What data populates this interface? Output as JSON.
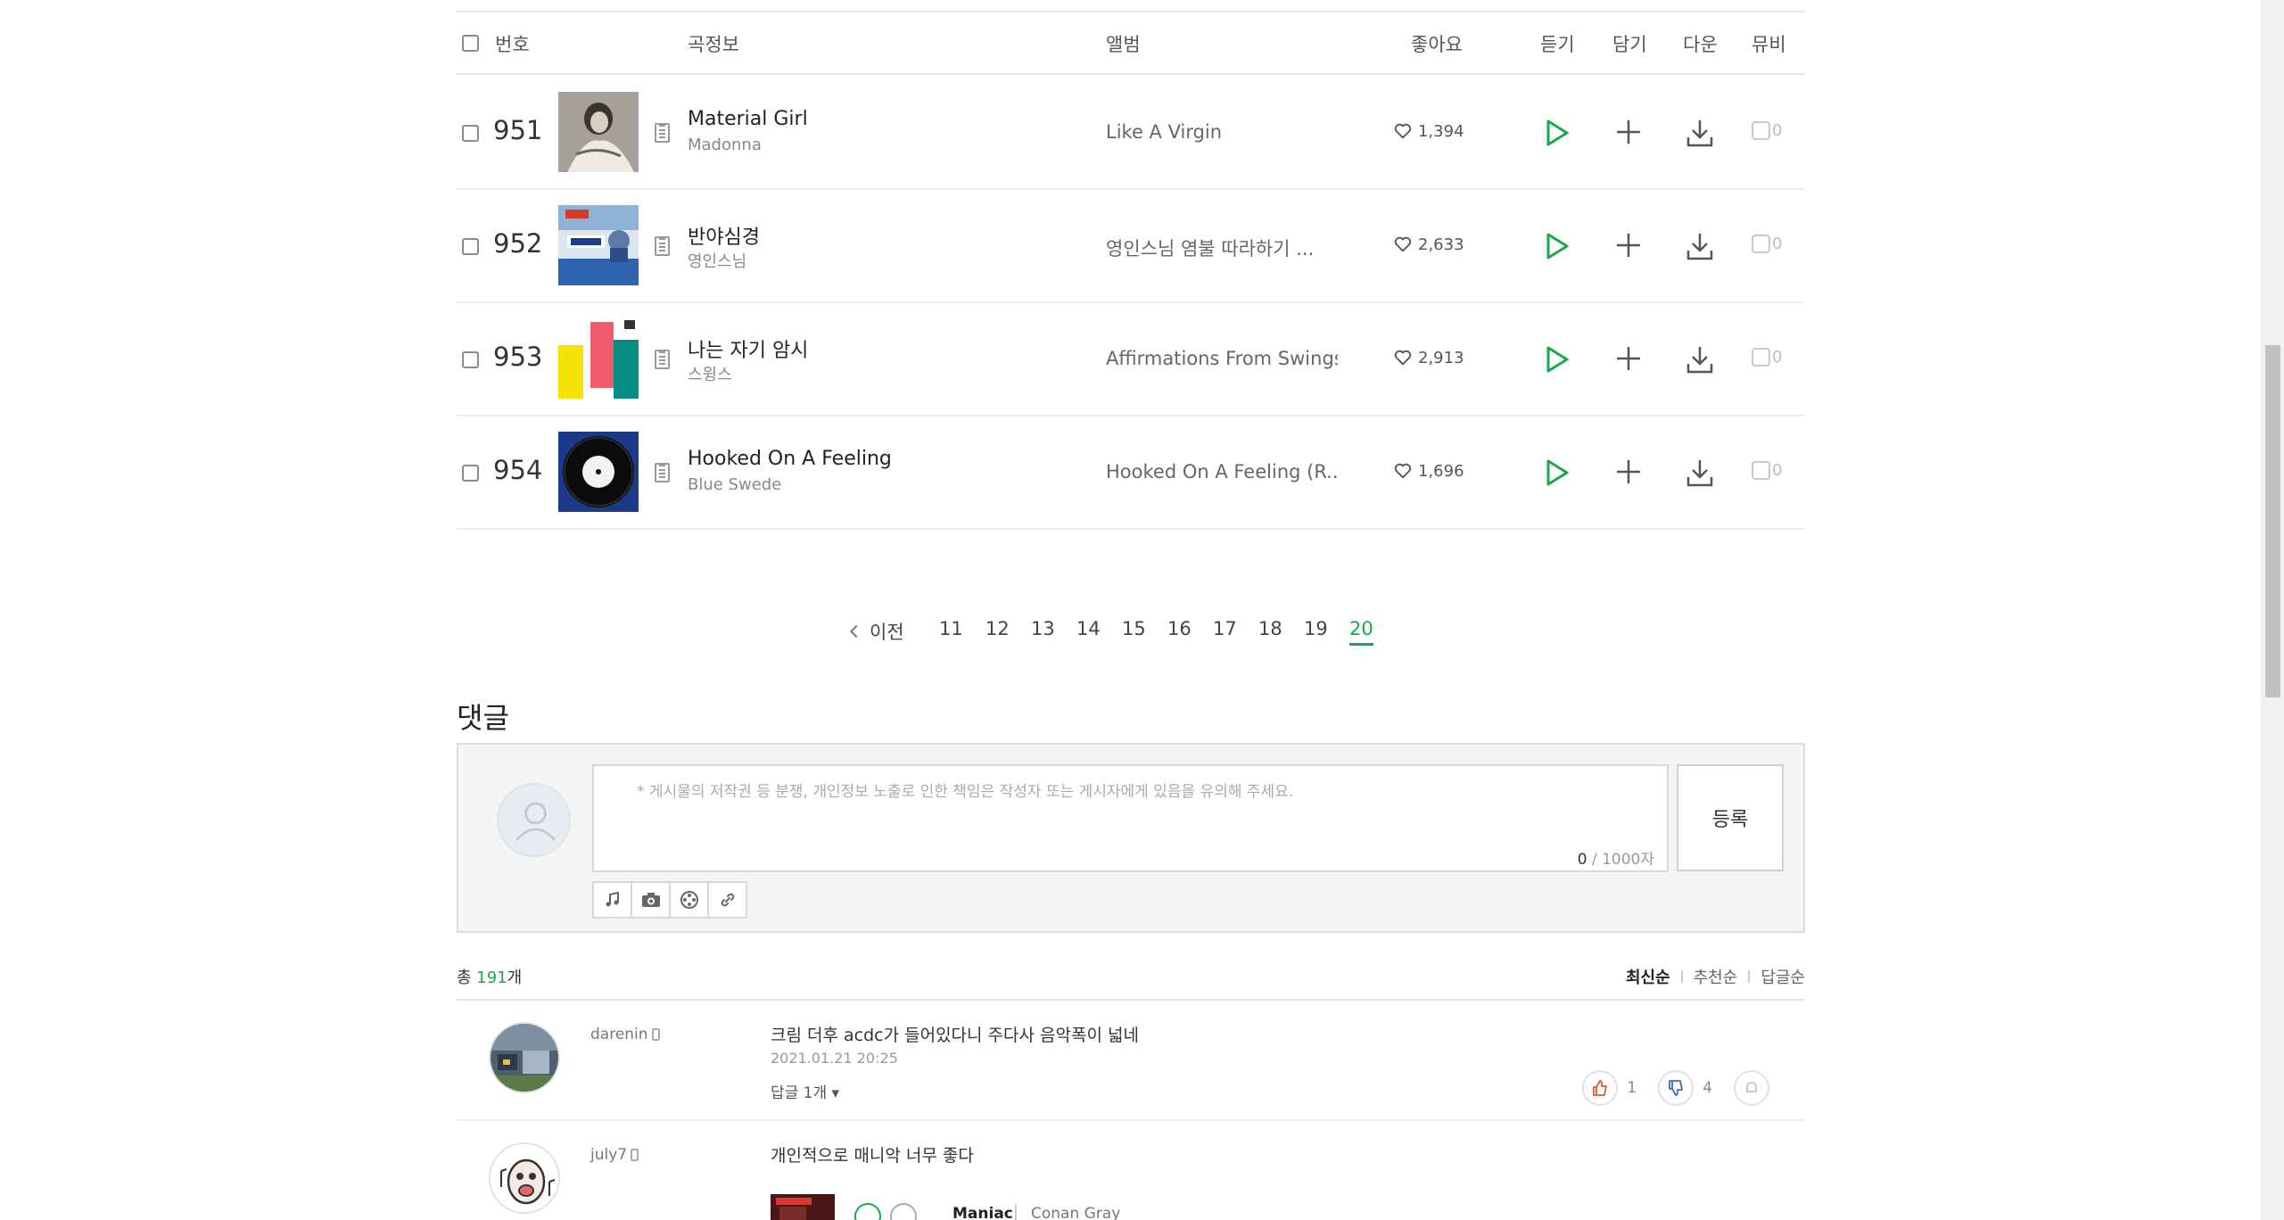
{
  "table": {
    "headers": {
      "number": "번호",
      "song_info": "곡정보",
      "album": "앨범",
      "likes": "좋아요",
      "listen": "듣기",
      "add": "담기",
      "download": "다운",
      "mv": "뮤비"
    },
    "rows": [
      {
        "rank": "951",
        "title": "Material Girl",
        "artist": "Madonna",
        "album": "Like A Virgin",
        "likes": "1,394",
        "mv_count": "0"
      },
      {
        "rank": "952",
        "title": "반야심경",
        "artist": "영인스님",
        "album": "영인스님 염불 따라하기 ...",
        "likes": "2,633",
        "mv_count": "0"
      },
      {
        "rank": "953",
        "title": "나는 자기 암시",
        "artist": "스윙스",
        "album": "Affirmations From Swings",
        "likes": "2,913",
        "mv_count": "0"
      },
      {
        "rank": "954",
        "title": "Hooked On A Feeling",
        "artist": "Blue Swede",
        "album": "Hooked On A Feeling (R...",
        "likes": "1,696",
        "mv_count": "0"
      }
    ]
  },
  "pagination": {
    "prev_label": "이전",
    "pages": [
      "11",
      "12",
      "13",
      "14",
      "15",
      "16",
      "17",
      "18",
      "19",
      "20"
    ],
    "active": "20"
  },
  "comments": {
    "title": "댓글",
    "placeholder": "* 게시물의 저작권 등 분쟁, 개인정보 노출로 인한 책임은 작성자 또는 게시자에게 있음을 유의해 주세요.",
    "char_count": "0",
    "char_limit": "/ 1000자",
    "submit_label": "등록",
    "total_prefix": "총",
    "total_count": "191",
    "total_suffix": "개",
    "sort": [
      "최신순",
      "추천순",
      "답글순"
    ],
    "list": [
      {
        "user": "darenin",
        "text": "크림 더후 acdc가 들어있다니 주다사 음악폭이 넓네",
        "date": "2021.01.21  20:25",
        "reply_label": "답글 1개",
        "likes": "1",
        "dislikes": "4"
      },
      {
        "user": "july7",
        "text": "개인적으로 매니악 너무 좋다",
        "attached_song_title": "Maniac",
        "attached_song_artist": "Conan Gray"
      }
    ]
  },
  "colors": {
    "accent_green": "#17a84a",
    "like_red": "#e8542e"
  }
}
